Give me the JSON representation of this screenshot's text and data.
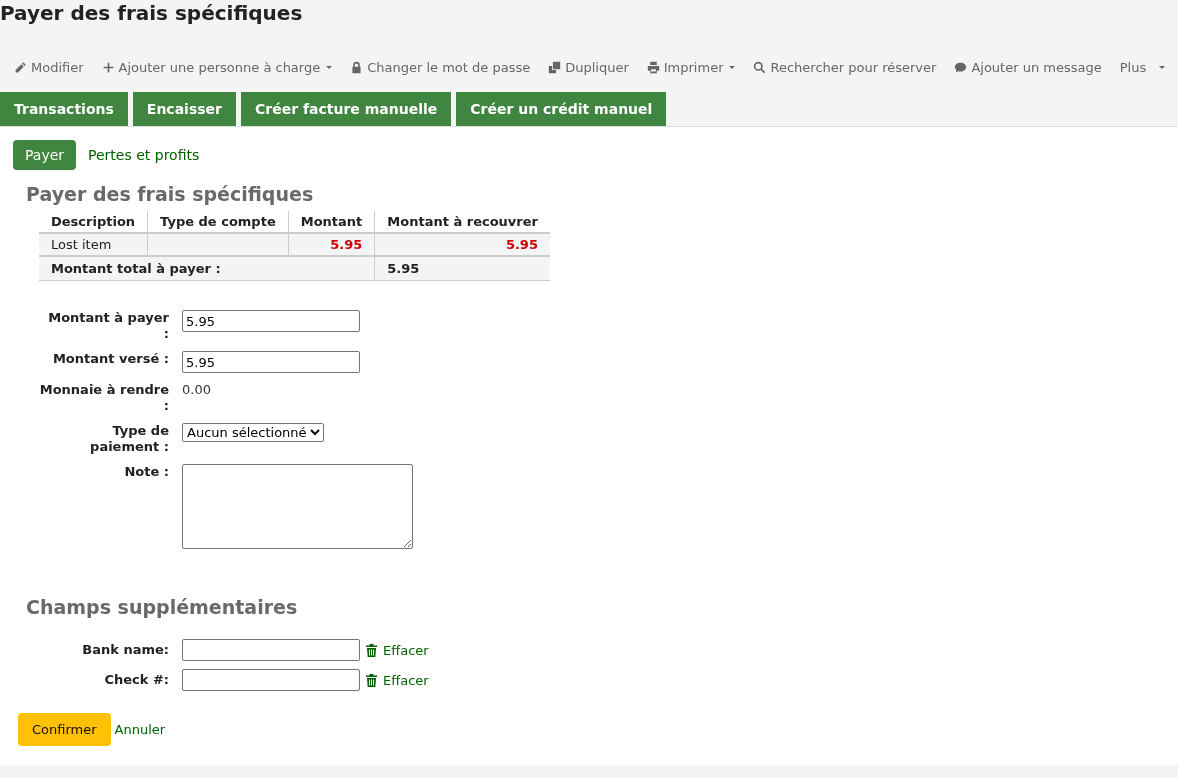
{
  "page_title": "Payer des frais spécifiques",
  "toolbar": [
    {
      "label": "Modifier",
      "kind": "pencil",
      "dropdown": false
    },
    {
      "label": "Ajouter une personne à charge",
      "kind": "plus",
      "dropdown": true
    },
    {
      "label": "Changer le mot de passe",
      "kind": "lock",
      "dropdown": false
    },
    {
      "label": "Dupliquer",
      "kind": "copy",
      "dropdown": false
    },
    {
      "label": "Imprimer",
      "kind": "printer",
      "dropdown": true
    },
    {
      "label": "Rechercher pour réserver",
      "kind": "search",
      "dropdown": false
    },
    {
      "label": "Ajouter un message",
      "kind": "comment",
      "dropdown": false
    },
    {
      "label": "Plus",
      "kind": "more",
      "dropdown": true
    }
  ],
  "tabs": [
    "Transactions",
    "Encaisser",
    "Créer facture manuelle",
    "Créer un crédit manuel"
  ],
  "subtabs": [
    {
      "label": "Payer",
      "selected": true
    },
    {
      "label": "Pertes et profits",
      "selected": false
    }
  ],
  "section_title": "Payer des frais spécifiques",
  "table": {
    "columns": [
      "Description",
      "Type de compte",
      "Montant",
      "Montant à recouvrer"
    ],
    "rows": [
      {
        "description": "Lost item",
        "account_type": "",
        "amount": "5.95",
        "outstanding": "5.95"
      }
    ],
    "total_label": "Montant total à payer :",
    "total": "5.95"
  },
  "form": [
    {
      "kind": "input",
      "label": "Montant à payer :",
      "value": "5.95"
    },
    {
      "kind": "input",
      "label": "Montant versé :",
      "value": "5.95"
    },
    {
      "kind": "text",
      "label": "Monnaie à rendre :",
      "value": "0.00"
    },
    {
      "kind": "select",
      "label": "Type de paiement :",
      "value": "Aucun sélectionné"
    },
    {
      "kind": "textarea",
      "label": "Note :"
    }
  ],
  "extra_title": "Champs supplémentaires",
  "extra_fields": [
    {
      "label": "Bank name:",
      "clear": "Effacer"
    },
    {
      "label": "Check #:",
      "clear": "Effacer"
    }
  ],
  "confirm": "Confirmer",
  "cancel": "Annuler"
}
